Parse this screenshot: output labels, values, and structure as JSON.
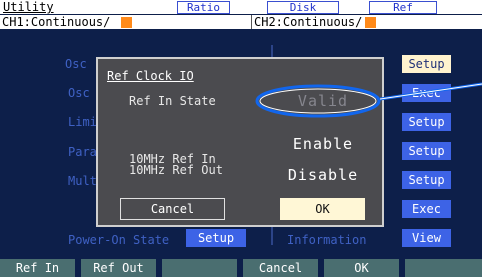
{
  "header": {
    "title": "Utility",
    "tabs": [
      "Ratio",
      "Disk",
      "Ref"
    ]
  },
  "channels": {
    "ch1": "CH1:Continuous/",
    "ch2": "CH2:Continuous/"
  },
  "background_menu": {
    "labels_left": [
      "Osc",
      "Osc",
      "Limi",
      "Para",
      "Mult"
    ],
    "power_on_label": "Power-On State",
    "power_on_button": "Setup",
    "information_label": "Information",
    "side_buttons": [
      "Setup",
      "Exec",
      "Setup",
      "Setup",
      "Setup",
      "Exec",
      "View"
    ]
  },
  "dialog": {
    "title": "Ref Clock IO",
    "rows": [
      {
        "label": "Ref In State",
        "value": "Valid"
      },
      {
        "label": "10MHz Ref In",
        "value": "Enable"
      },
      {
        "label": "10MHz Ref Out",
        "value": "Disable"
      }
    ],
    "cancel_label": "Cancel",
    "ok_label": "OK"
  },
  "function_keys": [
    "Ref In",
    "Ref Out",
    "",
    "Cancel",
    "OK",
    ""
  ],
  "colors": {
    "screen_bg": "#0d1f4a",
    "dialog_bg": "#4b4b4f",
    "button_blue": "#3d63e6",
    "fkey_teal": "#4a6e70",
    "ok_highlight": "#fff7d6",
    "annotation_blue": "#1166ee",
    "channel_marker": "#ff8a1a"
  }
}
